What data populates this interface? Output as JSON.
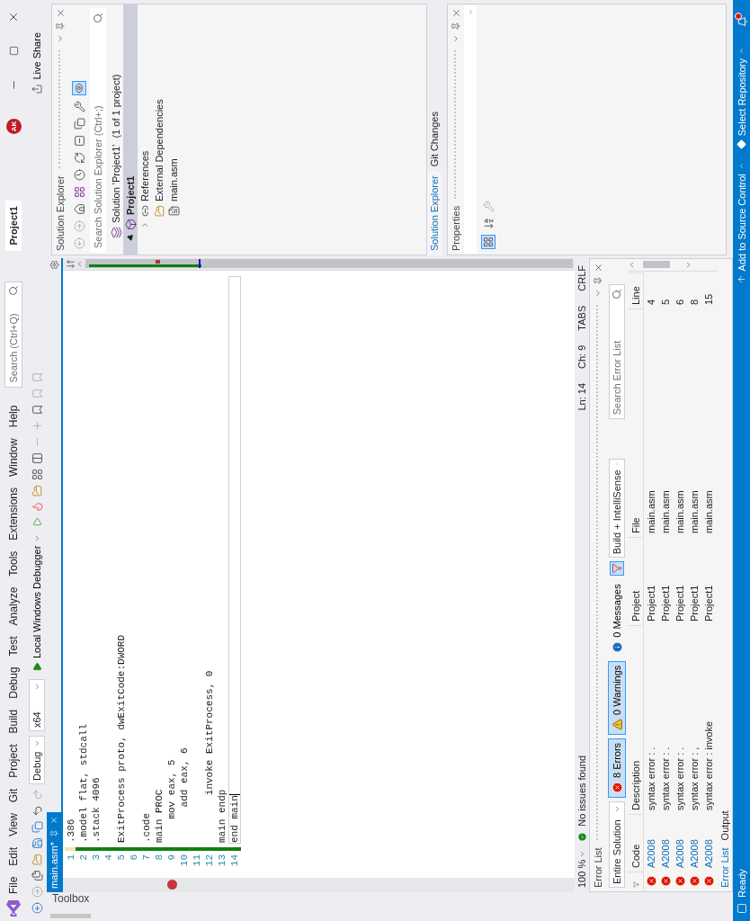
{
  "menu": [
    "File",
    "Edit",
    "View",
    "Git",
    "Project",
    "Build",
    "Debug",
    "Test",
    "Analyze",
    "Tools",
    "Extensions",
    "Window",
    "Help"
  ],
  "search": {
    "placeholder": "Search (Ctrl+Q)"
  },
  "title": "Project1",
  "avatar": "AK",
  "toolbar": {
    "configuration": "Debug",
    "platform": "x64",
    "debugger": "Local Windows Debugger",
    "live_share": "Live Share"
  },
  "toolbox": "Toolbox",
  "editor": {
    "tab": {
      "label": "main.asm*",
      "selected": true
    },
    "lines": [
      {
        "number": "1",
        "code": ".386",
        "current": false,
        "breakpoint": false
      },
      {
        "number": "2",
        "code": ".model flat, stdcall",
        "current": false,
        "breakpoint": false
      },
      {
        "number": "3",
        "code": ".stack 4096",
        "current": false,
        "breakpoint": false
      },
      {
        "number": "4",
        "current": false,
        "breakpoint": false
      },
      {
        "number": "5",
        "code": "ExitProcess proto, dwExitCode:DWORD",
        "current": false,
        "breakpoint": false
      },
      {
        "number": "6",
        "current": false,
        "breakpoint": false
      },
      {
        "number": "7",
        "code": ".code",
        "current": false,
        "breakpoint": false
      },
      {
        "number": "8",
        "code": "main PROC",
        "current": false,
        "breakpoint": false
      },
      {
        "number": "9",
        "code": "    mov eax, 5",
        "current": false,
        "breakpoint": true
      },
      {
        "number": "10",
        "code": "      add eax, 6",
        "current": false,
        "breakpoint": false
      },
      {
        "number": "11",
        "current": false,
        "breakpoint": false
      },
      {
        "number": "12",
        "code": "        invoke ExitProcess, 0",
        "current": false,
        "breakpoint": false
      },
      {
        "number": "13",
        "code": "main endp",
        "current": false,
        "breakpoint": false
      },
      {
        "number": "14",
        "code": "end main",
        "current": true,
        "breakpoint": false
      }
    ],
    "zoom": "100 %",
    "issues": "No issues found",
    "position": [
      "Ln: 14",
      "Ch: 9",
      "TABS",
      "CRLF"
    ]
  },
  "error_list": {
    "title": "Error List",
    "scope": "Entire Solution",
    "filters": [
      {
        "label": "8 Errors",
        "kind": "error",
        "selected": true
      },
      {
        "label": "0 Warnings",
        "kind": "warning",
        "selected": true
      },
      {
        "label": "0 Messages",
        "kind": "message",
        "selected": false
      }
    ],
    "filter_toggle": {
      "selected": true
    },
    "source": "Build + IntelliSense",
    "search": {
      "placeholder": "Search Error List"
    },
    "columns": [
      "Code",
      "Description",
      "Project",
      "File",
      "Line"
    ],
    "rows": [
      {
        "code": "A2008",
        "description": "syntax error : .",
        "project": "Project1",
        "file": "main.asm",
        "line": "4"
      },
      {
        "code": "A2008",
        "description": "syntax error : .",
        "project": "Project1",
        "file": "main.asm",
        "line": "5"
      },
      {
        "code": "A2008",
        "description": "syntax error : .",
        "project": "Project1",
        "file": "main.asm",
        "line": "6"
      },
      {
        "code": "A2008",
        "description": "syntax error : ,",
        "project": "Project1",
        "file": "main.asm",
        "line": "8"
      },
      {
        "code": "A2008",
        "description": "syntax error : invoke",
        "project": "Project1",
        "file": "main.asm",
        "line": "15"
      }
    ],
    "tabs": [
      {
        "label": "Error List",
        "selected": true
      },
      {
        "label": "Output",
        "selected": false
      }
    ]
  },
  "solution_explorer": {
    "title": "Solution Explorer",
    "search": {
      "placeholder": "Search Solution Explorer (Ctrl+;)"
    },
    "tree": [
      {
        "label": "Solution 'Project1'",
        "note": "(1 of 1 project)",
        "kind": "solution",
        "selected": false,
        "children": [
          {
            "label": "Project1",
            "kind": "project",
            "expanded": true,
            "selected": true,
            "children": [
              {
                "label": "References",
                "kind": "references",
                "expanded": false,
                "selected": false
              },
              {
                "label": "External Dependencies",
                "kind": "dependencies",
                "selected": false
              },
              {
                "label": "main.asm",
                "kind": "file",
                "selected": false
              }
            ]
          }
        ]
      }
    ],
    "tabs": [
      {
        "label": "Solution Explorer",
        "selected": true
      },
      {
        "label": "Git Changes",
        "selected": false
      }
    ]
  },
  "properties": {
    "title": "Properties"
  },
  "status_bar": {
    "state": "Ready",
    "source_control": "Add to Source Control",
    "repository": "Select Repository"
  }
}
